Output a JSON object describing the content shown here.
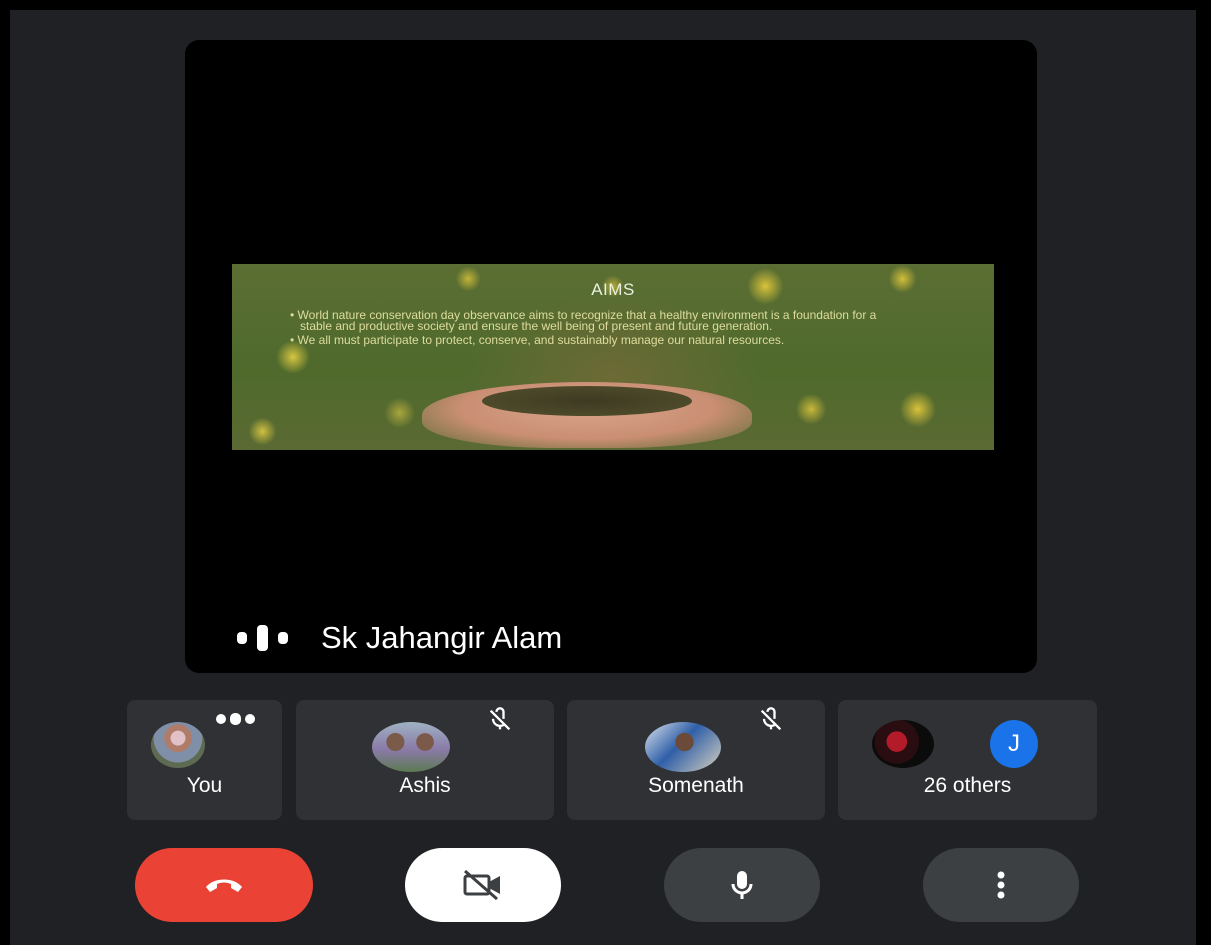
{
  "stage": {
    "slide": {
      "title": "AIMS",
      "bullets": [
        "World nature conservation day observance aims to recognize that a healthy environment is a foundation for a stable and productive society and ensure the well being of present and future generation.",
        "We all must participate to protect, conserve, and sustainably manage our natural resources."
      ]
    },
    "speaker_name": "Sk Jahangir Alam"
  },
  "participants": [
    {
      "name": "You",
      "mic": "speaking"
    },
    {
      "name": "Ashis",
      "mic": "muted"
    },
    {
      "name": "Somenath",
      "mic": "muted"
    },
    {
      "name": "26 others",
      "avatar_initial": "J"
    }
  ],
  "controls": [
    {
      "name": "leave-call-button",
      "icon": "phone-hangup-icon",
      "color": "#ea4335"
    },
    {
      "name": "camera-toggle-button",
      "icon": "video-off-icon",
      "color": "#ffffff"
    },
    {
      "name": "microphone-button",
      "icon": "mic-icon",
      "color": "#3c4043"
    },
    {
      "name": "more-options-button",
      "icon": "more-vert-icon",
      "color": "#3c4043"
    }
  ],
  "colors": {
    "background": "#202124",
    "stage": "#000000",
    "tile": "#303134",
    "accent_blue": "#1a73e8",
    "hangup_red": "#ea4335"
  }
}
